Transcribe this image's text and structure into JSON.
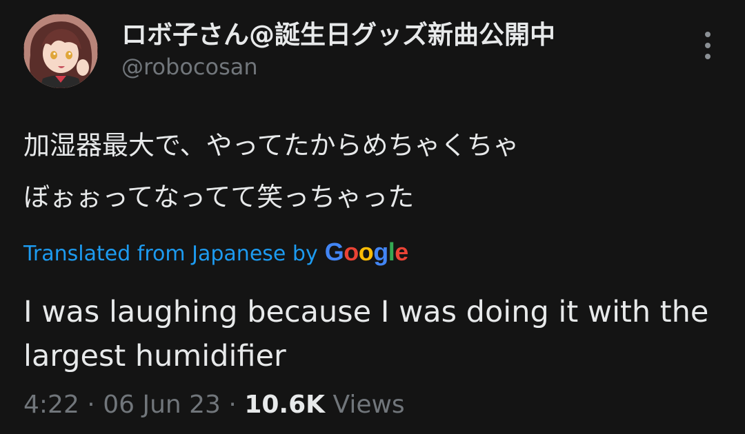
{
  "tweet": {
    "display_name": "ロボ子さん@誕生日グッズ新曲公開中",
    "handle": "@robocosan",
    "original_line1": "加湿器最大で、やってたからめちゃくちゃ",
    "original_line2": "ぼぉぉってなってて笑っちゃった",
    "translated_from": "Translated from Japanese by",
    "translation": "I was laughing because I was doing it with the largest humidifier",
    "time": "4:22",
    "separator": "·",
    "date": "06 Jun 23",
    "views_count": "10.6K",
    "views_label": "Views"
  },
  "google_logo": {
    "letters": [
      "G",
      "o",
      "o",
      "g",
      "l",
      "e"
    ],
    "colors": [
      "#4285F4",
      "#EA4335",
      "#FBBC05",
      "#4285F4",
      "#34A853",
      "#EA4335"
    ]
  },
  "icons": {
    "more": "more-vertical-icon",
    "avatar": "profile-avatar"
  },
  "colors": {
    "background": "#141414",
    "text_primary": "#e7e9ea",
    "text_secondary": "#71767b",
    "link_blue": "#1d9bf0"
  }
}
